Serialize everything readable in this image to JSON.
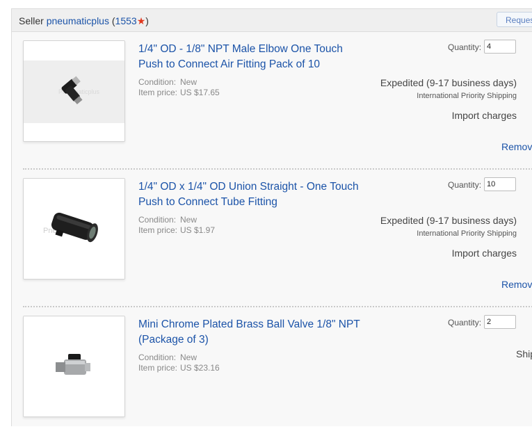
{
  "seller": {
    "label": "Seller",
    "name": "pneumaticplus",
    "open_paren": " (",
    "score": "1553",
    "star": "★",
    "close_paren": ")",
    "request_button": "Request total"
  },
  "common": {
    "quantity_label": "Quantity:",
    "condition_label": "Condition:",
    "price_label": "Item price:",
    "import_charges": "Import charges",
    "remove_label": "Remove"
  },
  "items": [
    {
      "title": "1/4\" OD - 1/8\" NPT Male Elbow One Touch Push to Connect Air Fitting Pack of 10",
      "condition": "New",
      "price": "US $17.65",
      "quantity": "4",
      "shipping": "Expedited (9-17 business days)",
      "shipping_service": "International Priority Shipping",
      "image": "elbow-fitting-image"
    },
    {
      "title": "1/4\" OD x 1/4\" OD Union Straight - One Touch Push to Connect Tube Fitting",
      "condition": "New",
      "price": "US $1.97",
      "quantity": "10",
      "shipping": "Expedited (9-17 business days)",
      "shipping_service": "International Priority Shipping",
      "image": "union-fitting-image"
    },
    {
      "title": "Mini Chrome Plated Brass Ball Valve 1/8\" NPT (Package of 3)",
      "condition": "New",
      "price": "US $23.16",
      "quantity": "2",
      "shipping_cut": "Ship",
      "image": "ball-valve-image"
    }
  ],
  "colors": {
    "link": "#1b53a8",
    "star": "#e0371e",
    "panel_bg": "#f8f8f8"
  }
}
